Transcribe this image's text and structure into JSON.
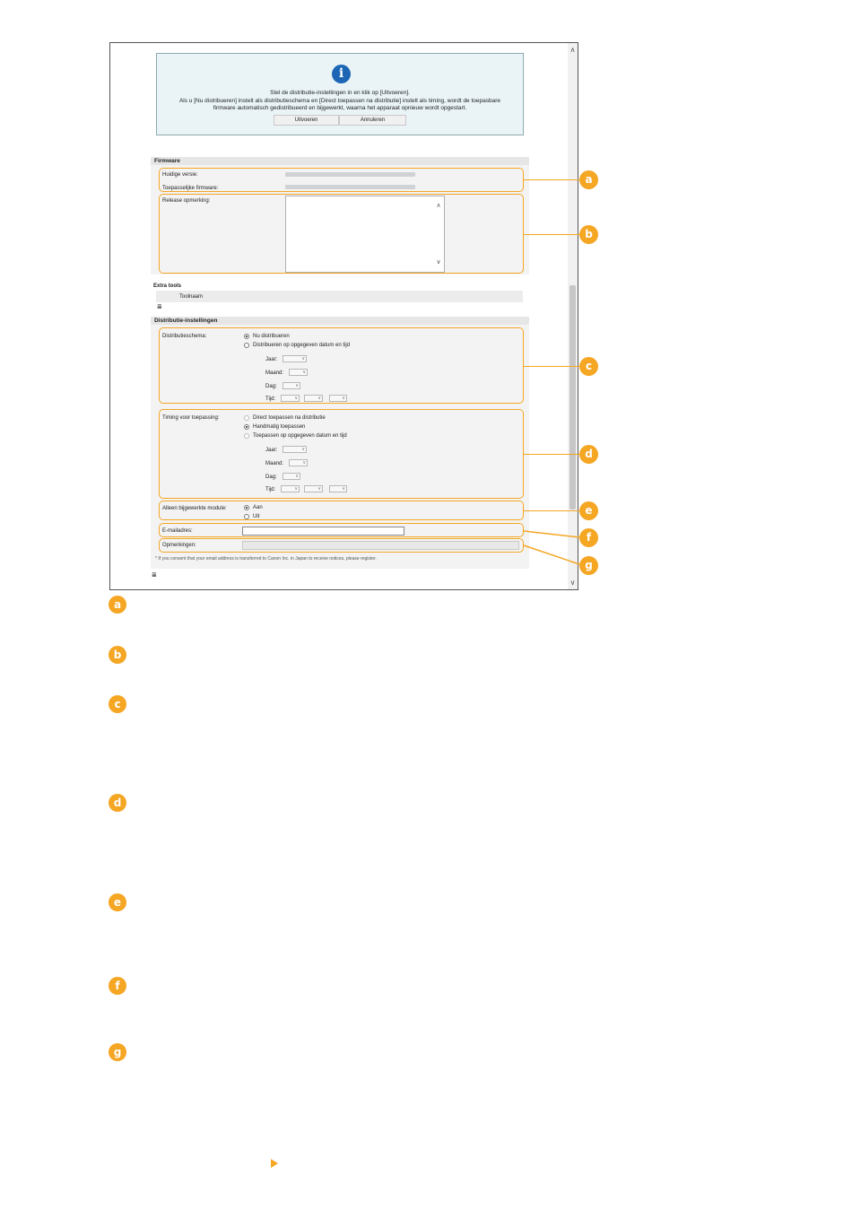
{
  "info": {
    "title": "Stel de distributie-instellingen in en klik op [Uitvoeren].",
    "line1": "Als u [Nu distribueren] instelt als distributieschema en [Direct toepassen na distributie] instelt als timing, wordt de toepasbare",
    "line2": "firmware automatisch gedistribueerd en bijgewerkt, waarna het apparaat opnieuw wordt opgestart.",
    "execute_label": "Uitvoeren",
    "cancel_label": "Annuleren"
  },
  "firmware": {
    "heading": "Firmware",
    "current_version_label": "Huidige versie:",
    "applicable_firmware_label": "Toepasselijke firmware:",
    "release_note_label": "Release opmerking:"
  },
  "extra_tools": {
    "heading": "Extra tools",
    "column_tool_name": "Toolnaam"
  },
  "distribution": {
    "heading": "Distributie-instellingen",
    "schedule_label": "Distributieschema:",
    "schedule_options": [
      "Nu distribueren",
      "Distribueren op opgegeven datum en tijd"
    ],
    "schedule_selected": 0,
    "year_label": "Jaar:",
    "month_label": "Maand:",
    "day_label": "Dag:",
    "time_label": "Tijd:",
    "timing_label": "Timing voor toepassing:",
    "timing_options": [
      "Direct toepassen na distributie",
      "Handmatig toepassen",
      "Toepassen op opgegeven datum en tijd"
    ],
    "timing_selected": 1,
    "updated_module_label": "Alleen bijgewerkte module:",
    "updated_module_options": [
      "Aan",
      "Uit"
    ],
    "updated_module_selected": 0,
    "email_label": "E-mailadres:",
    "remarks_label": "Opmerkingen:",
    "footnote": "* If you consent that your email address is transferred to Canon Inc. in Japan to receive notices, please register."
  },
  "badges": [
    "a",
    "b",
    "c",
    "d",
    "e",
    "f",
    "g"
  ],
  "colors": {
    "accent": "#f5a623",
    "info_icon": "#1c66b5",
    "info_bg": "#eaf4f7"
  }
}
